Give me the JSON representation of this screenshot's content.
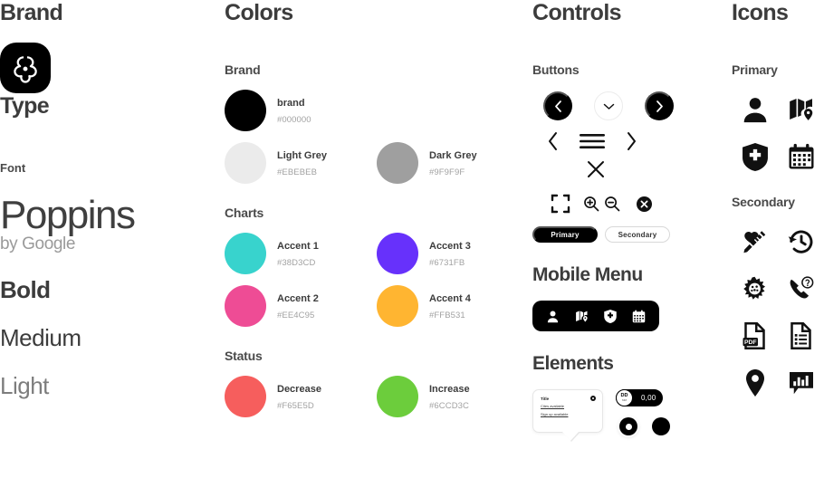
{
  "columns": {
    "brand": {
      "title": "Brand"
    },
    "colors": {
      "title": "Colors"
    },
    "controls": {
      "title": "Controls"
    },
    "icons": {
      "title": "Icons"
    }
  },
  "brand": {
    "logo_icon": "trillium-logo-icon",
    "type_heading": "Type",
    "font_label": "Font",
    "font_name": "Poppins",
    "font_by": "by Google",
    "weights": [
      {
        "label": "Bold",
        "weight": "bold"
      },
      {
        "label": "Medium",
        "weight": "medium"
      },
      {
        "label": "Light",
        "weight": "light"
      }
    ]
  },
  "colors": {
    "groups": [
      {
        "name": "Brand",
        "swatches": [
          {
            "name": "brand",
            "hex": "#000000"
          },
          {
            "name": "Light Grey",
            "hex": "#EBEBEB"
          },
          {
            "name": "Dark Grey",
            "hex": "#9F9F9F"
          }
        ]
      },
      {
        "name": "Charts",
        "swatches": [
          {
            "name": "Accent 1",
            "hex": "#38D3CD"
          },
          {
            "name": "Accent 3",
            "hex": "#6731FB"
          },
          {
            "name": "Accent 2",
            "hex": "#EE4C95"
          },
          {
            "name": "Accent 4",
            "hex": "#FFB531"
          }
        ]
      },
      {
        "name": "Status",
        "swatches": [
          {
            "name": "Decrease",
            "hex": "#F65E5D"
          },
          {
            "name": "Increase",
            "hex": "#6CCD3C"
          }
        ]
      }
    ]
  },
  "controls": {
    "buttons_heading": "Buttons",
    "circle_buttons": [
      {
        "icon": "chevron-left-icon",
        "style": "dark"
      },
      {
        "icon": "chevron-down-icon",
        "style": "ghost"
      },
      {
        "icon": "chevron-right-icon",
        "style": "dark"
      }
    ],
    "plain_buttons": [
      {
        "icon": "chevron-left-icon"
      },
      {
        "icon": "hamburger-menu-icon"
      },
      {
        "icon": "chevron-right-icon"
      }
    ],
    "close_button": {
      "icon": "close-x-icon"
    },
    "utility_buttons": [
      {
        "icon": "fullscreen-icon"
      },
      {
        "icon": "zoom-in-icon"
      },
      {
        "icon": "zoom-out-icon"
      },
      {
        "icon": "close-circle-filled-icon"
      }
    ],
    "pills": [
      {
        "label": "Primary",
        "style": "primary"
      },
      {
        "label": "Secondary",
        "style": "secondary"
      }
    ],
    "mobile_menu_heading": "Mobile Menu",
    "mobile_menu_icons": [
      "person-icon",
      "map-pin-icon",
      "shield-cross-icon",
      "calendar-icon"
    ],
    "elements_heading": "Elements",
    "tooltip": {
      "title": "Title",
      "link_1": "Cites available",
      "link_2": "Sign up available",
      "gear_icon": "gear-icon"
    },
    "value_pill": {
      "knob_label": "DD",
      "knob_sublabel": "MM",
      "value": "0,00"
    },
    "radios": [
      {
        "name": "radio-selected",
        "state": "on"
      },
      {
        "name": "radio-filled",
        "state": "off"
      }
    ]
  },
  "icons": {
    "groups": [
      {
        "name": "Primary",
        "items": [
          "person-icon",
          "map-pin-icon",
          "shield-cross-icon",
          "calendar-icon"
        ]
      },
      {
        "name": "Secondary",
        "items": [
          "vaccine-heart-icon",
          "clock-history-icon",
          "virus-icon",
          "phone-question-icon",
          "pdf-file-icon",
          "document-list-icon",
          "location-pin-icon",
          "chart-bubble-icon"
        ]
      }
    ]
  }
}
